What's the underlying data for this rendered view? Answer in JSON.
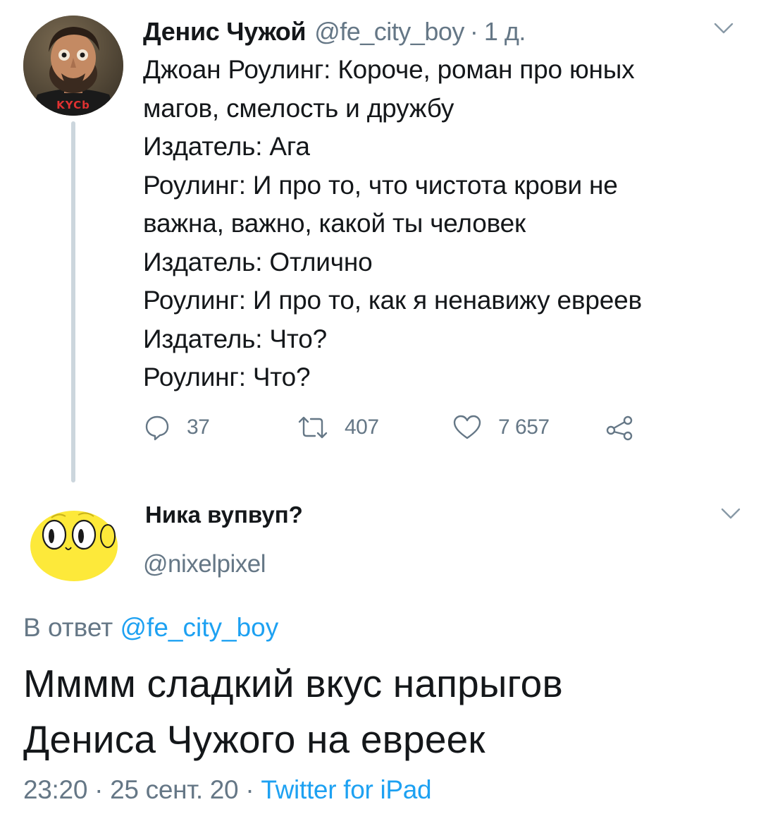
{
  "tweet": {
    "author_name": "Денис Чужой",
    "author_handle": "@fe_city_boy",
    "separator": "·",
    "time_ago": "1 д.",
    "avatar_shirt_text": "KYCb",
    "body_lines": [
      "Джоан Роулинг: Короче, роман про юных",
      "магов, смелость и дружбу",
      "Издатель: Ага",
      "Роулинг: И про то, что чистота крови не",
      "важна, важно, какой ты человек",
      "Издатель: Отлично",
      "Роулинг: И про то, как я ненавижу евреев",
      "Издатель: Что?",
      "Роулинг: Что?"
    ],
    "actions": {
      "reply_count": "37",
      "retweet_count": "407",
      "like_count": "7 657",
      "icons": [
        "reply-icon",
        "retweet-icon",
        "like-icon",
        "share-icon"
      ]
    }
  },
  "reply": {
    "author_name": "Ника вупвуп?",
    "author_handle": "@nixelpixel",
    "reply_to_prefix": "В ответ",
    "reply_to_handle": "@fe_city_boy",
    "body_lines": [
      "Мммм сладкий вкус напрыгов",
      "Дениса Чужого на евреек"
    ],
    "time": "23:20",
    "separator": "·",
    "date": "25 сент. 20",
    "source": "Twitter for iPad"
  },
  "colors": {
    "text": "#14171a",
    "secondary": "#657786",
    "link": "#1da1f2",
    "thread_line": "#ccd6dd",
    "avatar2_yellow": "#fde93a"
  }
}
